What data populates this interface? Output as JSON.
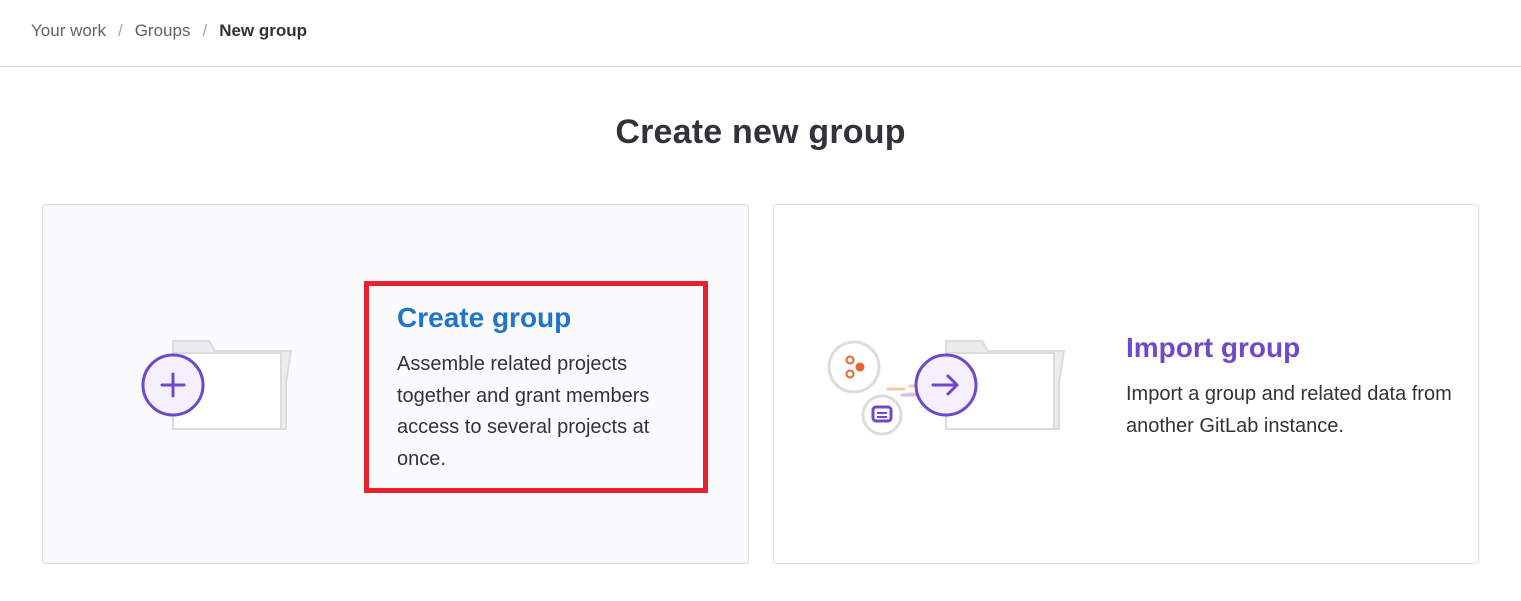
{
  "breadcrumb": {
    "items": [
      "Your work",
      "Groups"
    ],
    "separator": "/",
    "current": "New group"
  },
  "page": {
    "title": "Create new group"
  },
  "cards": {
    "create": {
      "title": "Create group",
      "description": "Assemble related projects together and grant members access to several projects at once.",
      "icon": "folder-plus-icon"
    },
    "import": {
      "title": "Import group",
      "description": "Import a group and related data from another GitLab instance.",
      "icon": "folder-import-icon"
    }
  },
  "colors": {
    "create_link": "#1f75cb",
    "import_link": "#6e49cb",
    "accent_purple": "#6e49cb",
    "accent_orange": "#e9642c",
    "highlight": "#e8222c"
  }
}
